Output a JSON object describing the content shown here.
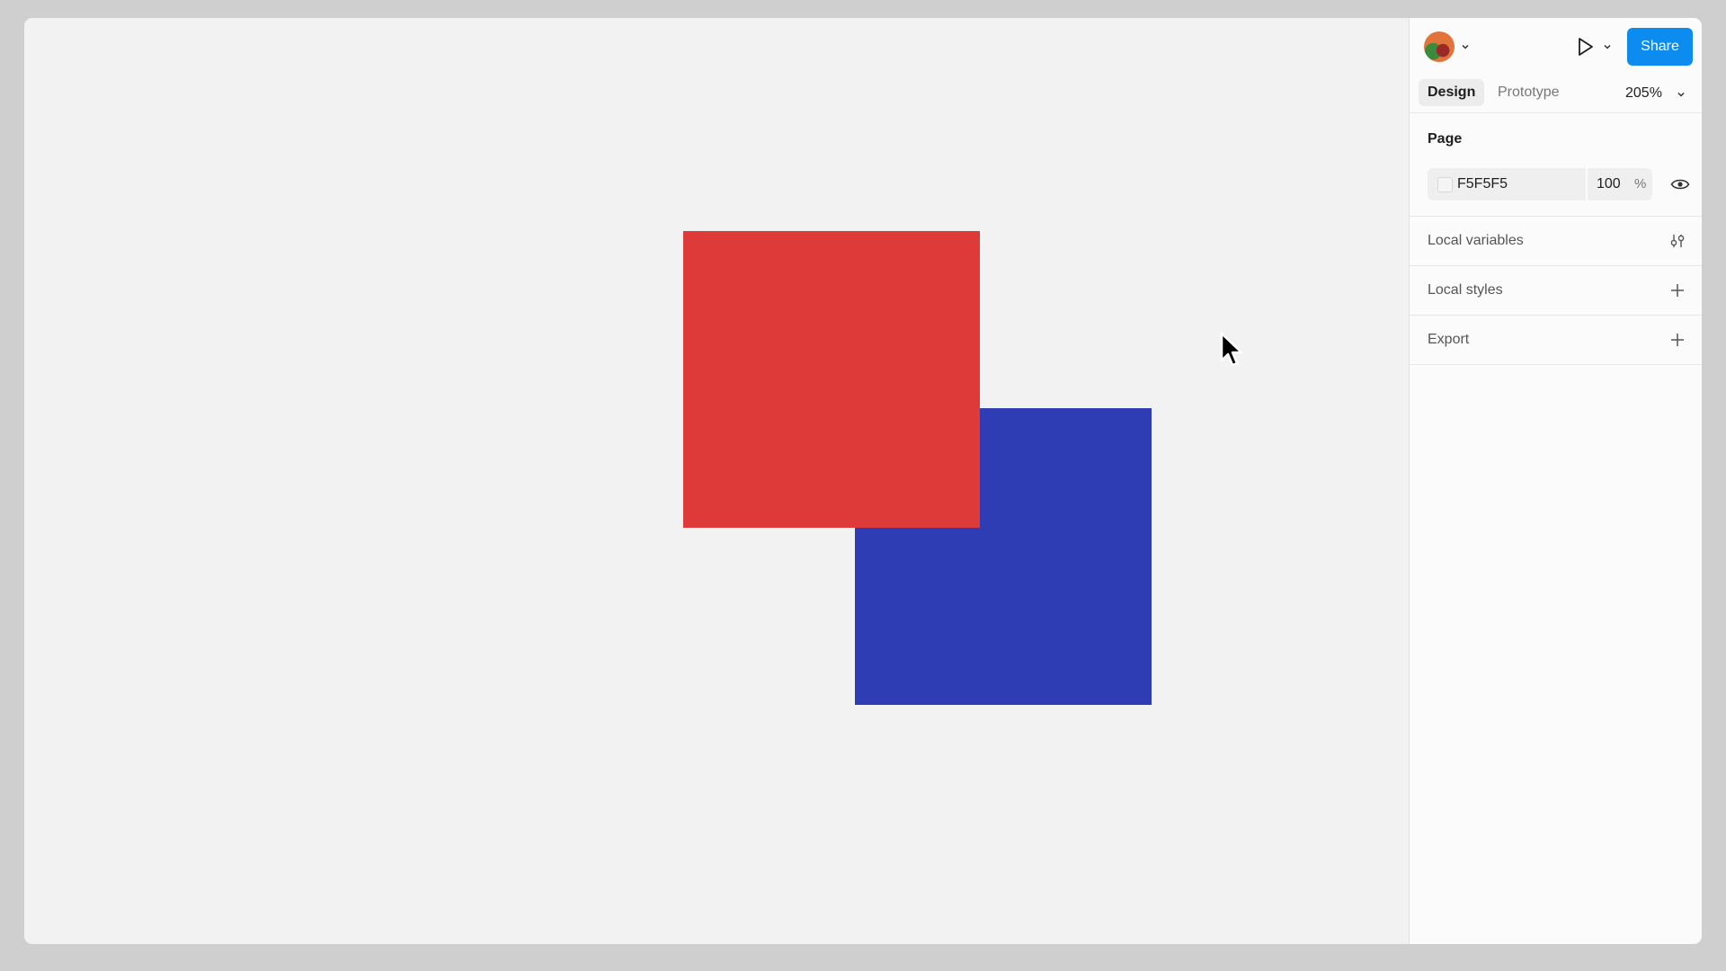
{
  "canvas": {
    "background_color": "#f2f2f2",
    "shapes": [
      {
        "name": "blue-rectangle",
        "color": "#2f3db5"
      },
      {
        "name": "red-rectangle",
        "color": "#de3a3a"
      }
    ]
  },
  "header": {
    "avatar_icon": "user-avatar",
    "play_icon": "play-icon",
    "share_label": "Share",
    "share_color": "#0d8cf0"
  },
  "tabs": {
    "design_label": "Design",
    "prototype_label": "Prototype",
    "zoom": "205%"
  },
  "page_section": {
    "title": "Page",
    "fill_hex": "F5F5F5",
    "opacity": "100",
    "opacity_unit": "%",
    "visibility_icon": "eye-icon"
  },
  "rows": {
    "local_variables": "Local variables",
    "local_styles": "Local styles",
    "export": "Export"
  }
}
